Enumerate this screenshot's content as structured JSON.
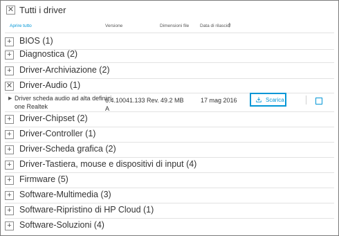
{
  "header": {
    "title": "Tutti i driver",
    "collapse_glyph": "✕"
  },
  "columns": {
    "expand_all": "Aprire tutto",
    "version": "Versione",
    "file_size": "Dimensioni file",
    "release_date": "Data di rilascio"
  },
  "categories": [
    {
      "label": "BIOS (1)",
      "glyph": "+"
    },
    {
      "label": "Diagnostica (2)",
      "glyph": "+"
    },
    {
      "label": "Driver-Archiviazione (2)",
      "glyph": "+"
    },
    {
      "label": "Driver-Audio (1)",
      "glyph": "✕"
    },
    {
      "label": "Driver-Chipset (2)",
      "glyph": "+"
    },
    {
      "label": "Driver-Controller (1)",
      "glyph": "+"
    },
    {
      "label": "Driver-Scheda grafica (2)",
      "glyph": "+"
    },
    {
      "label": "Driver-Tastiera, mouse e dispositivi di input (4)",
      "glyph": "+"
    },
    {
      "label": "Firmware (5)",
      "glyph": "+"
    },
    {
      "label": "Software-Multimedia (3)",
      "glyph": "+"
    },
    {
      "label": "Software-Ripristino di HP Cloud (1)",
      "glyph": "+"
    },
    {
      "label": "Software-Soluzioni (4)",
      "glyph": "+"
    }
  ],
  "driver": {
    "expand_glyph": "▶",
    "name_line1": "Driver scheda audio ad alta definizi",
    "name_line2": "one Realtek",
    "version_line1": "6.4.10041.133 Rev.",
    "version_line2": "A",
    "size": "49.2 MB",
    "date": "17 mag 2016",
    "download_label": "Scarica",
    "download_icon": "download-icon"
  },
  "colors": {
    "accent": "#0096d6",
    "text": "#333333",
    "border": "#7a7a7a"
  }
}
